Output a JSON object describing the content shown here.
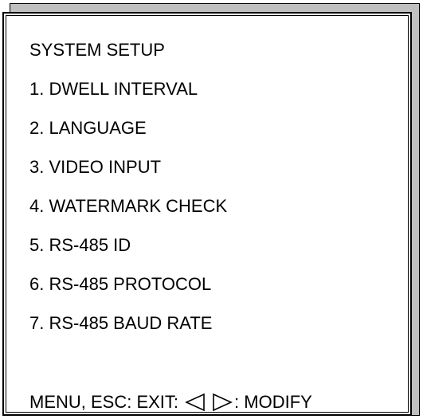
{
  "menu": {
    "title": "SYSTEM SETUP",
    "items": [
      "1. DWELL INTERVAL",
      "2. LANGUAGE",
      "3. VIDEO INPUT",
      "4. WATERMARK CHECK",
      "5. RS-485 ID",
      "6. RS-485 PROTOCOL",
      "7. RS-485 BAUD RATE"
    ]
  },
  "footer": {
    "exit_label": "MENU, ESC: EXIT:",
    "left_icon": "left-triangle-arrow-icon",
    "right_icon": "right-triangle-arrow-icon",
    "modify_label": ": MODIFY"
  }
}
